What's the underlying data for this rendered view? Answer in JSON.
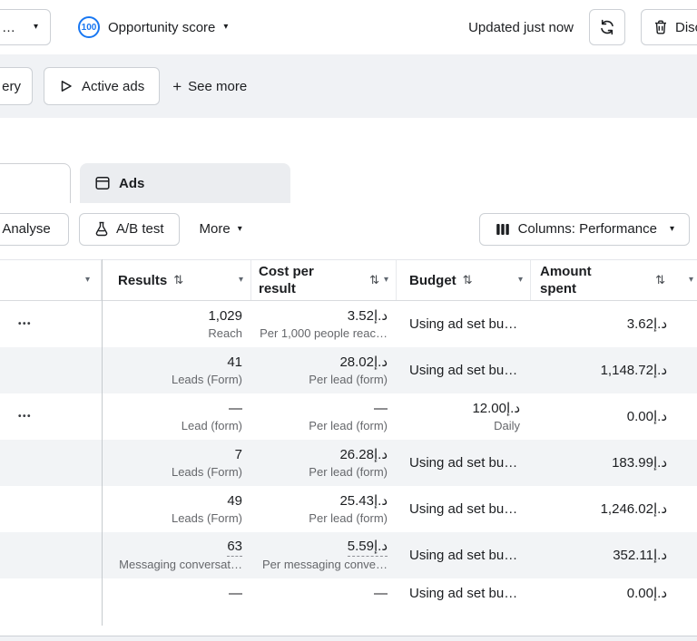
{
  "topbar": {
    "truncated_dropdown": "…",
    "score_badge": "100",
    "score_label": "Opportunity score",
    "updated_text": "Updated just now",
    "discard_label": "Disc"
  },
  "filter_bar": {
    "truncated_filter": "ery",
    "active_ads": "Active ads",
    "see_more": "See more"
  },
  "tabs": {
    "ads": "Ads"
  },
  "toolbar": {
    "analyse": "Analyse",
    "ab_test": "A/B test",
    "more": "More",
    "columns": "Columns: Performance"
  },
  "table": {
    "headers": [
      "",
      "Results",
      "Cost per result",
      "Budget",
      "Amount spent"
    ],
    "rows": [
      {
        "menu": true,
        "results": "1,029",
        "results_label": "Reach",
        "cost": "3.52د.إ",
        "cost_label": "Per 1,000 people reac…",
        "budget": "Using ad set bu…",
        "spent": "3.62د.إ"
      },
      {
        "menu": false,
        "results": "41",
        "results_label": "Leads (Form)",
        "cost": "28.02د.إ",
        "cost_label": "Per lead (form)",
        "budget": "Using ad set bu…",
        "spent": "1,148.72د.إ"
      },
      {
        "menu": true,
        "results": "—",
        "results_label": "Lead (form)",
        "cost": "—",
        "cost_label": "Per lead (form)",
        "budget": "12.00د.إ",
        "budget_label": "Daily",
        "budget_align": "right",
        "spent": "0.00د.إ"
      },
      {
        "menu": false,
        "results": "7",
        "results_label": "Leads (Form)",
        "cost": "26.28د.إ",
        "cost_label": "Per lead (form)",
        "budget": "Using ad set bu…",
        "spent": "183.99د.إ"
      },
      {
        "menu": false,
        "results": "49",
        "results_label": "Leads (Form)",
        "cost": "25.43د.إ",
        "cost_label": "Per lead (form)",
        "budget": "Using ad set bu…",
        "spent": "1,246.02د.إ"
      },
      {
        "menu": false,
        "results": "63",
        "results_dashed": true,
        "results_label": "Messaging conversat…",
        "cost": "5.59د.إ",
        "cost_dashed": true,
        "cost_label": "Per messaging conve…",
        "budget": "Using ad set bu…",
        "spent": "352.11د.إ"
      },
      {
        "menu": false,
        "results": "—",
        "cost": "—",
        "budget": "Using ad set bu…",
        "spent": "0.00د.إ"
      }
    ]
  },
  "icons": {
    "chevron_down": "▾",
    "sort": "⇅",
    "plus": "+",
    "row_menu": "•••"
  },
  "colors": {
    "accent_blue": "#1877f2"
  }
}
